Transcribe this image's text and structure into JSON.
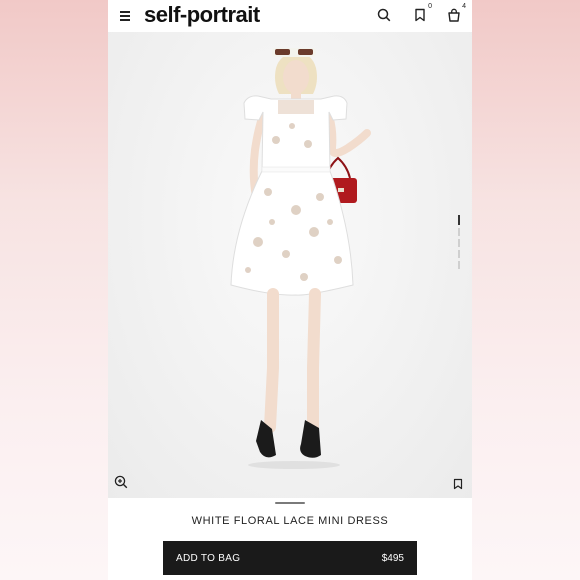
{
  "header": {
    "logo": "self-portrait",
    "wishlist_count": "0",
    "bag_count": "4",
    "icons": [
      "hamburger-menu-icon",
      "search-icon",
      "bookmark-icon",
      "shopping-bag-icon"
    ]
  },
  "gallery": {
    "image": "model wearing white floral lace mini dress with red handbag and black heeled sandals",
    "icons": [
      "zoom-in-icon",
      "bookmark-icon"
    ]
  },
  "product": {
    "name": "WHITE FLORAL LACE MINI DRESS",
    "price": "$495",
    "add_to_bag_label": "ADD TO BAG"
  },
  "colors": {
    "background_top": "#f1c9c7",
    "button": "#1a1a1a",
    "bag": "#b01a1e",
    "dress": "#ffffff"
  }
}
